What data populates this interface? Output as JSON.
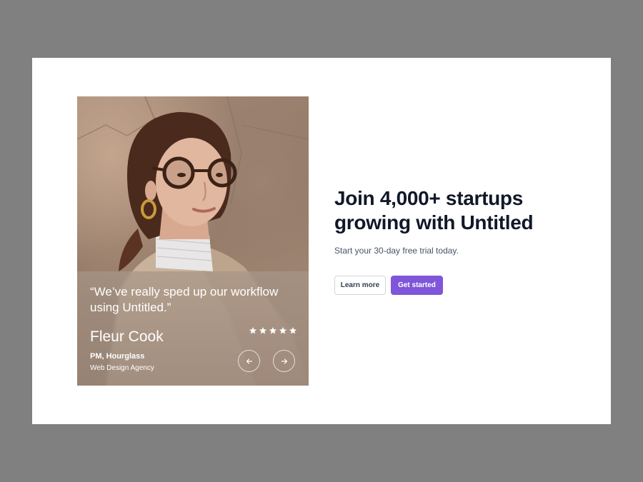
{
  "testimonial": {
    "quote": "“We’ve really sped up our workflow using Untitled.”",
    "name": "Fleur Cook",
    "role": "PM, Hourglass",
    "company": "Web Design Agency",
    "rating": 5,
    "rating_max": 5,
    "prev_icon": "arrow-left-icon",
    "next_icon": "arrow-right-icon"
  },
  "hero": {
    "heading_line1": "Join 4,000+ startups",
    "heading_line2": "growing with Untitled",
    "subtitle": "Start your 30-day free trial today.",
    "secondary_button": "Learn more",
    "primary_button": "Get started"
  },
  "colors": {
    "primary": "#7f56d9",
    "heading": "#101828",
    "body_text": "#475467",
    "backdrop": "#808080"
  }
}
